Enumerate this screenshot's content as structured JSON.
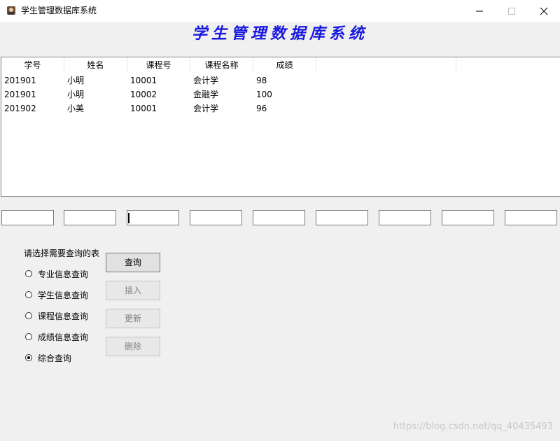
{
  "window": {
    "title": "学生管理数据库系统",
    "icon": "app-icon",
    "controls": [
      "minimize-icon",
      "maximize-icon",
      "close-icon"
    ]
  },
  "banner": {
    "text": "学生管理数据库系统",
    "color": "#1818e0"
  },
  "table": {
    "columns": [
      "学号",
      "姓名",
      "课程号",
      "课程名称",
      "成绩"
    ],
    "rows": [
      [
        "201901",
        "小明",
        "10001",
        "会计学",
        "98"
      ],
      [
        "201901",
        "小明",
        "10002",
        "金融学",
        "100"
      ],
      [
        "201902",
        "小美",
        "10001",
        "会计学",
        "96"
      ]
    ]
  },
  "inputs": {
    "count": 9,
    "values": [
      "",
      "",
      "",
      "",
      "",
      "",
      "",
      "",
      ""
    ]
  },
  "query_panel": {
    "prompt": "请选择需要查询的表",
    "options": [
      {
        "label": "专业信息查询",
        "checked": false
      },
      {
        "label": "学生信息查询",
        "checked": false
      },
      {
        "label": "课程信息查询",
        "checked": false
      },
      {
        "label": "成绩信息查询",
        "checked": false
      },
      {
        "label": "综合查询",
        "checked": true
      }
    ]
  },
  "buttons": {
    "query": {
      "label": "查询",
      "enabled": true
    },
    "insert": {
      "label": "插入",
      "enabled": false
    },
    "update": {
      "label": "更新",
      "enabled": false
    },
    "delete": {
      "label": "删除",
      "enabled": false
    }
  },
  "watermark": "https://blog.csdn.net/qq_40435493"
}
